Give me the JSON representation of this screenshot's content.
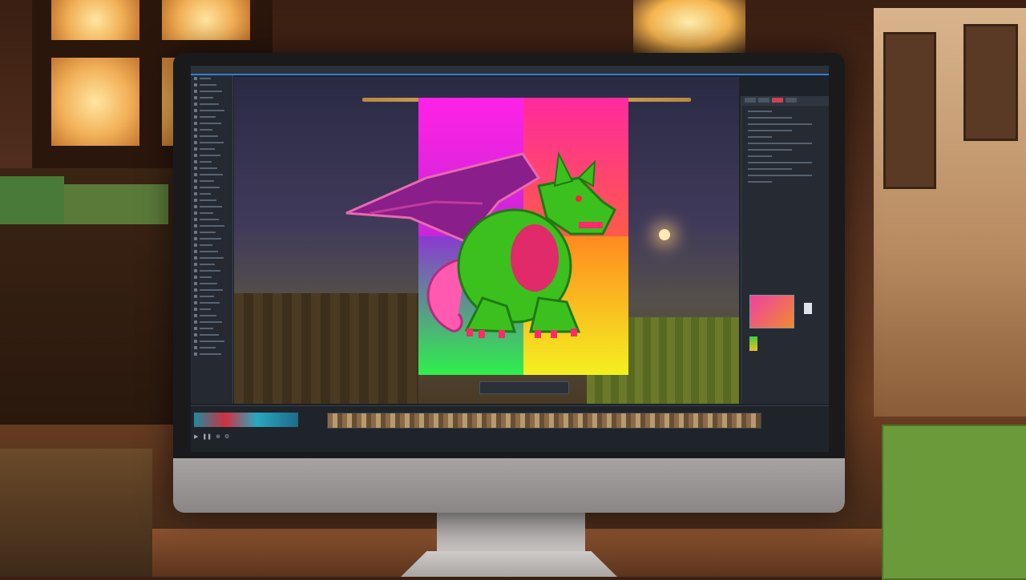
{
  "app": {
    "title": ""
  },
  "canvas": {
    "status_text": ""
  },
  "colors": {
    "accent": "#2f7fd1",
    "poster_magenta": "#ff22e6",
    "poster_pink": "#ff2a9e",
    "poster_green": "#2ef04a",
    "poster_yellow": "#f4f020",
    "dragon_green": "#3cc01e",
    "dragon_wing": "#8a1e8a"
  },
  "icons": [
    "dragon-illustration-icon",
    "play-icon",
    "zoom-icon",
    "layer-thumbnail-icon"
  ]
}
